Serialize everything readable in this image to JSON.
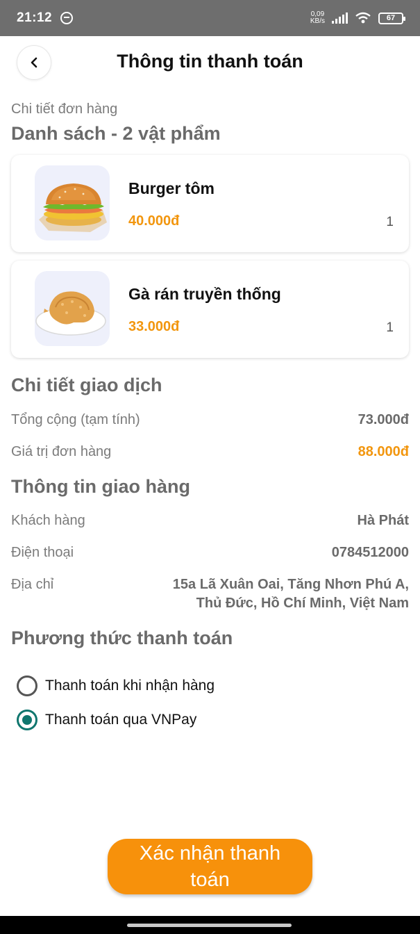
{
  "status_bar": {
    "time": "21:12",
    "net_speed_value": "0,09",
    "net_speed_unit": "KB/s",
    "battery": "67"
  },
  "header": {
    "title": "Thông tin thanh toán"
  },
  "order": {
    "section_label": "Chi tiết đơn hàng",
    "list_title": "Danh sách - 2 vật phẩm",
    "items": [
      {
        "name": "Burger tôm",
        "price": "40.000đ",
        "quantity": "1",
        "icon": "burger-image"
      },
      {
        "name": "Gà rán truyền thống",
        "price": "33.000đ",
        "quantity": "1",
        "icon": "fried-chicken-image"
      }
    ]
  },
  "transaction": {
    "title": "Chi tiết giao dịch",
    "subtotal_label": "Tổng cộng (tạm tính)",
    "subtotal_value": "73.000đ",
    "order_value_label": "Giá trị đơn hàng",
    "order_value": "88.000đ"
  },
  "delivery": {
    "title": "Thông tin giao hàng",
    "customer_label": "Khách hàng",
    "customer_value": "Hà Phát",
    "phone_label": "Điện thoại",
    "phone_value": "0784512000",
    "address_label": "Địa chỉ",
    "address_line1": "15a Lã Xuân Oai, Tăng Nhơn Phú A,",
    "address_line2": "Thủ Đức, Hồ Chí Minh, Việt Nam"
  },
  "payment": {
    "title": "Phương thức thanh toán",
    "options": [
      {
        "label": "Thanh toán khi nhận hàng",
        "selected": false
      },
      {
        "label": "Thanh toán qua VNPay",
        "selected": true
      }
    ]
  },
  "confirm": {
    "label": "Xác nhận thanh toán"
  },
  "colors": {
    "accent": "#f7910b",
    "price": "#f2960e",
    "radio_selected": "#0f766e"
  }
}
